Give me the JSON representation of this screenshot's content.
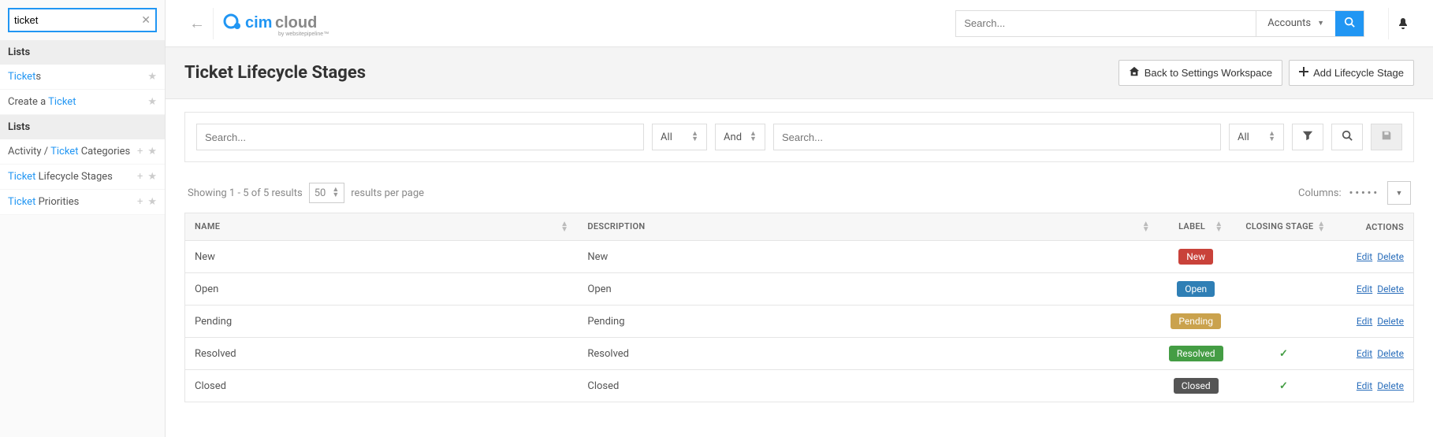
{
  "sidebar": {
    "search_value": "ticket",
    "groups": [
      {
        "label": "Lists",
        "items": [
          {
            "pre": "",
            "hl": "Ticket",
            "post": "s",
            "has_plus": false
          },
          {
            "pre": "Create a ",
            "hl": "Ticket",
            "post": "",
            "has_plus": false
          }
        ]
      },
      {
        "label": "Lists",
        "items": [
          {
            "pre": "Activity / ",
            "hl": "Ticket",
            "post": " Categories",
            "has_plus": true
          },
          {
            "pre": "",
            "hl": "Ticket",
            "post": " Lifecycle Stages",
            "has_plus": true
          },
          {
            "pre": "",
            "hl": "Ticket",
            "post": " Priorities",
            "has_plus": true
          }
        ]
      }
    ]
  },
  "topbar": {
    "search_placeholder": "Search...",
    "search_scope": "Accounts"
  },
  "page": {
    "title": "Ticket Lifecycle Stages",
    "back_label": "Back to Settings Workspace",
    "add_label": "Add Lifecycle Stage"
  },
  "filters": {
    "search_placeholder": "Search...",
    "field_all": "All",
    "op": "And"
  },
  "results": {
    "showing": "Showing 1 - 5 of 5 results",
    "per_page": "50",
    "per_page_suffix": "results per page",
    "columns_label": "Columns:"
  },
  "table": {
    "headers": {
      "name": "NAME",
      "desc": "DESCRIPTION",
      "label": "LABEL",
      "closing": "CLOSING STAGE",
      "actions": "ACTIONS"
    },
    "rows": [
      {
        "name": "New",
        "desc": "New",
        "label": "New",
        "label_cls": "lbl-red",
        "closing": false
      },
      {
        "name": "Open",
        "desc": "Open",
        "label": "Open",
        "label_cls": "lbl-blue",
        "closing": false
      },
      {
        "name": "Pending",
        "desc": "Pending",
        "label": "Pending",
        "label_cls": "lbl-yellow",
        "closing": false
      },
      {
        "name": "Resolved",
        "desc": "Resolved",
        "label": "Resolved",
        "label_cls": "lbl-green",
        "closing": true
      },
      {
        "name": "Closed",
        "desc": "Closed",
        "label": "Closed",
        "label_cls": "lbl-dark",
        "closing": true
      }
    ],
    "edit": "Edit",
    "delete": "Delete"
  }
}
